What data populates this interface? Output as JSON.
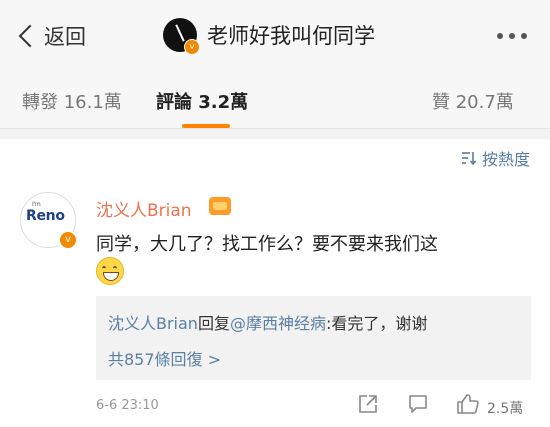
{
  "nav": {
    "back_label": "返回",
    "title": "老师好我叫何同学"
  },
  "tabs": {
    "repost": "轉發 16.1萬",
    "comment": "評論 3.2萬",
    "like": "贊 20.7萬"
  },
  "sort": {
    "label": "按熱度"
  },
  "comment": {
    "avatar_text": "Reno",
    "avatar_small_text": "I'm",
    "author": "沈义人Brian",
    "text": "同学，大几了？找工作么？要不要来我们这",
    "reply": {
      "author": "沈义人Brian",
      "verb": "回复",
      "mention": "@摩西神经病",
      "content": ":看完了，谢谢",
      "more": "共857條回復 >"
    },
    "time": "6-6 23:10",
    "likes": "2.5萬"
  },
  "icons": {
    "verified": "verified-v-icon",
    "vip": "vip-crown-icon",
    "emoji": "laughing-emoji-icon",
    "share": "share-icon",
    "comment": "comment-icon",
    "like": "thumbs-up-icon"
  },
  "colors": {
    "accent": "#ff8200",
    "link": "#5b7fa6",
    "author": "#eb7350"
  }
}
